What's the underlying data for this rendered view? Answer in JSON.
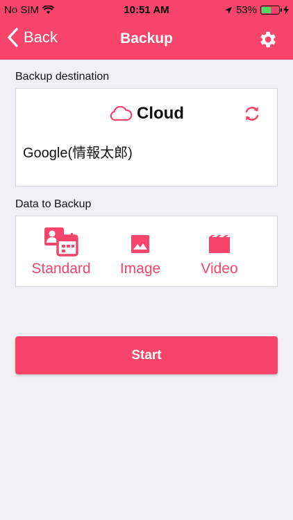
{
  "status_bar": {
    "carrier": "No SIM",
    "time": "10:51 AM",
    "battery": "53%",
    "battery_level": 0.53
  },
  "navbar": {
    "back_label": "Back",
    "title": "Backup"
  },
  "destination": {
    "section_label": "Backup destination",
    "service": "Cloud",
    "account": "Google(情報太郎)"
  },
  "data": {
    "section_label": "Data to Backup",
    "items": [
      {
        "label": "Standard",
        "icon": "contacts-calendar-icon"
      },
      {
        "label": "Image",
        "icon": "image-icon"
      },
      {
        "label": "Video",
        "icon": "video-clapper-icon"
      }
    ]
  },
  "start_label": "Start",
  "colors": {
    "accent": "#f7446b",
    "background": "#efeff4"
  }
}
